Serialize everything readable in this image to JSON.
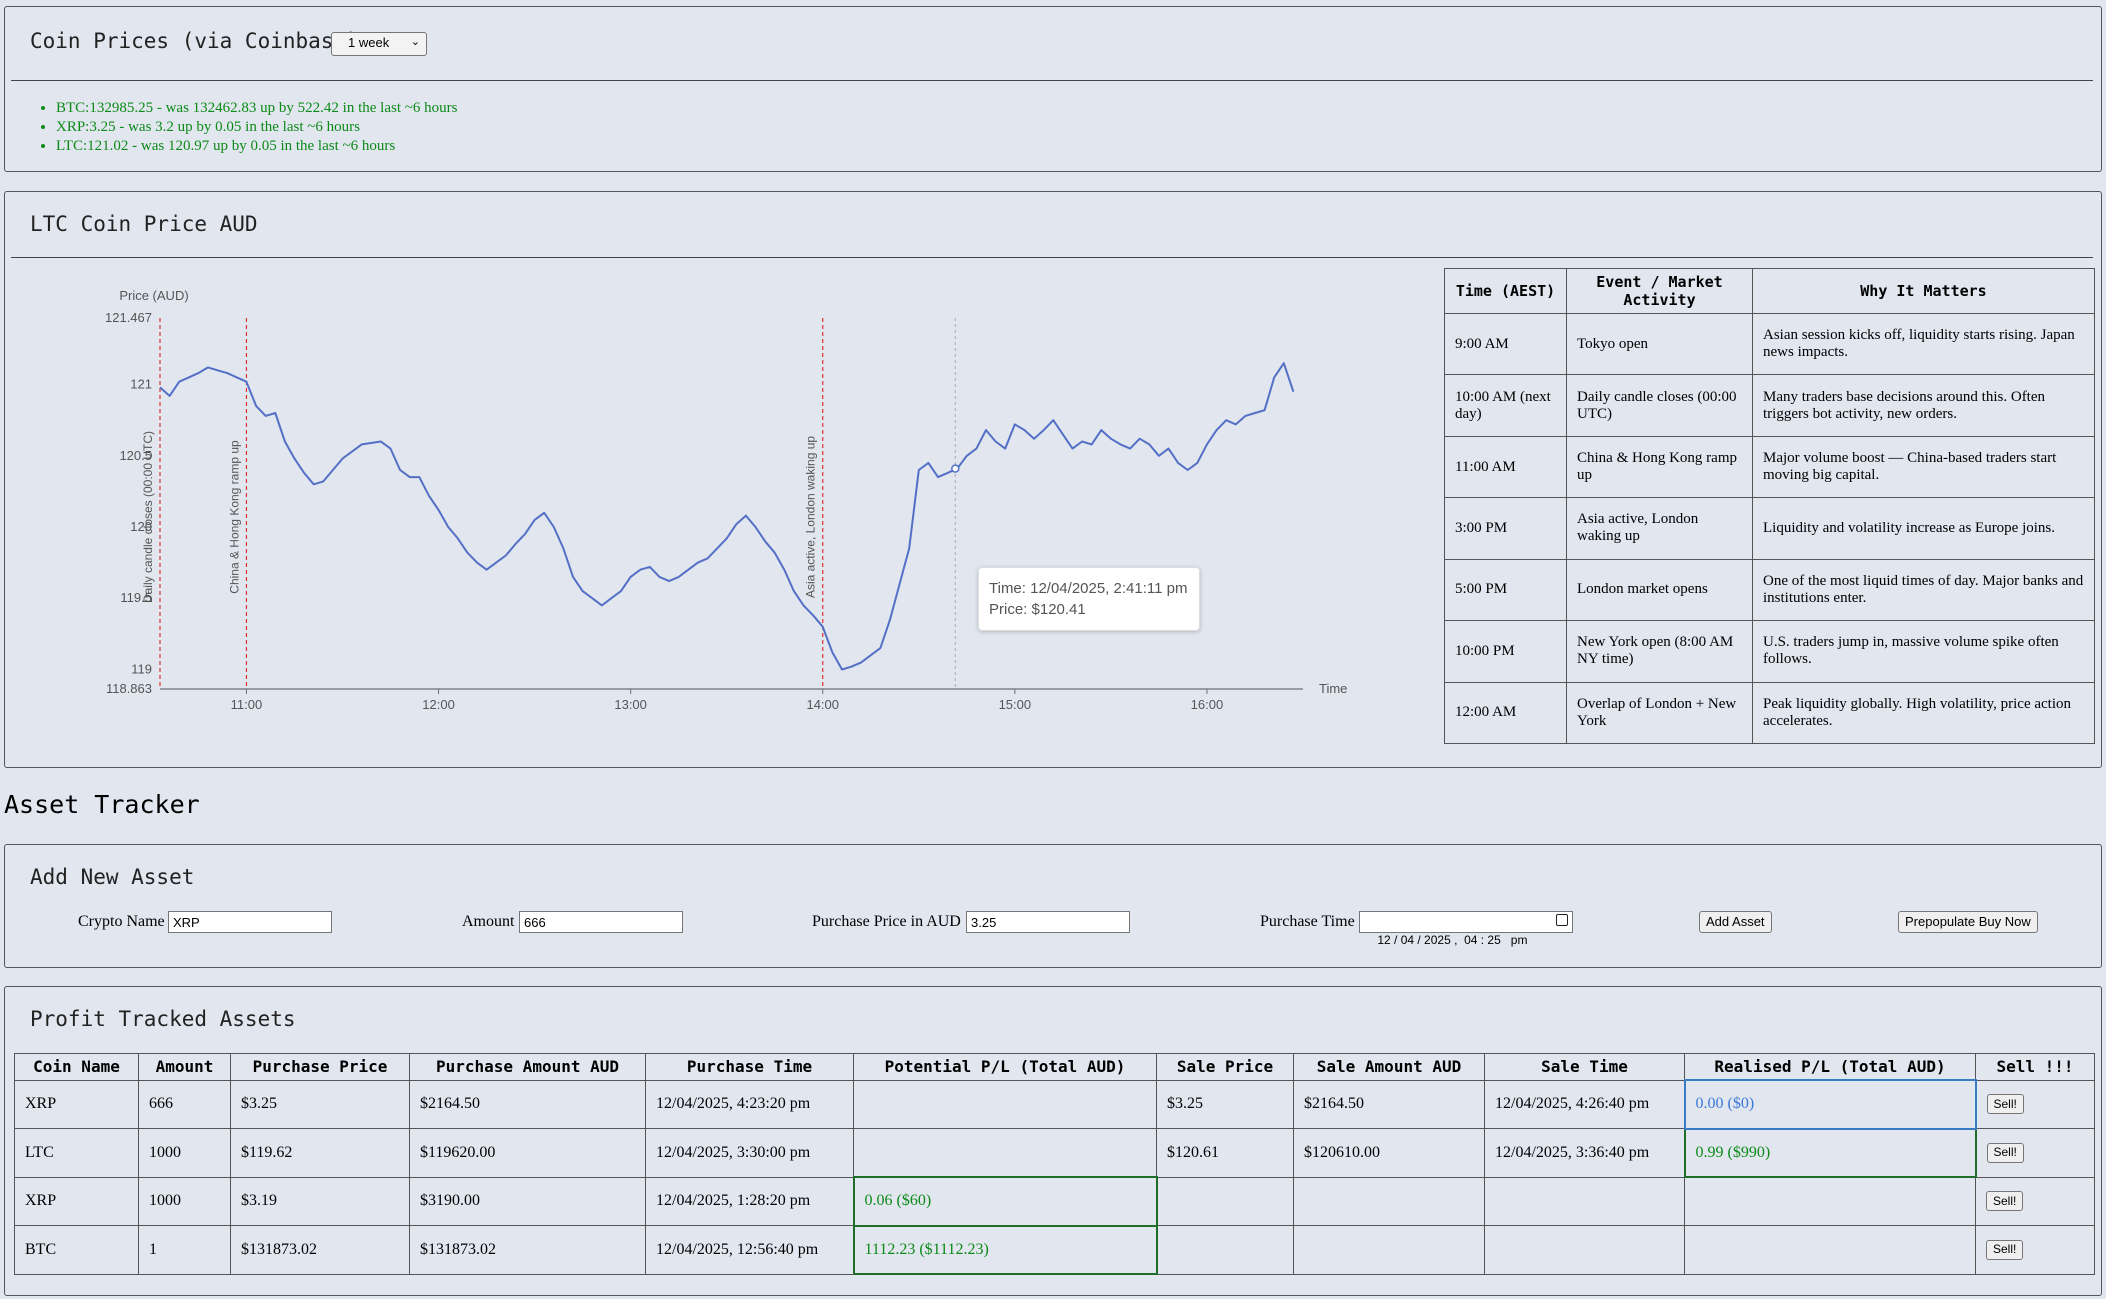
{
  "prices_panel": {
    "title": "Coin Prices (via Coinbase)",
    "range_selected": "1 week",
    "items": [
      "BTC:132985.25 - was 132462.83 up by 522.42 in the last ~6 hours",
      "XRP:3.25 - was 3.2 up by 0.05 in the last ~6 hours",
      "LTC:121.02 - was 120.97 up by 0.05 in the last ~6 hours"
    ],
    "up_color": "#0d8a18"
  },
  "chart_panel": {
    "title": "LTC Coin Price AUD",
    "tooltip": {
      "time": "Time: 12/04/2025, 2:41:11 pm",
      "price": "Price: $120.41"
    }
  },
  "chart_data": {
    "type": "line",
    "ylabel": "Price (AUD)",
    "xlabel": "Time",
    "y_ticks": [
      "121.467",
      "121",
      "120.5",
      "120",
      "119.5",
      "119",
      "118.863"
    ],
    "x_ticks": [
      "11:00",
      "12:00",
      "13:00",
      "14:00",
      "15:00",
      "16:00"
    ],
    "ylim": [
      118.863,
      121.467
    ],
    "xlim": [
      10.55,
      16.5
    ],
    "series_color": "#5470c6",
    "event_markers": [
      {
        "x": 10.55,
        "label": "Daily candle closes (00:00 UTC)"
      },
      {
        "x": 11.0,
        "label": "China & Hong Kong ramp up"
      },
      {
        "x": 14.0,
        "label": "Asia active, London waking up"
      }
    ],
    "hover_x": 14.69,
    "x": [
      10.55,
      10.6,
      10.65,
      10.7,
      10.75,
      10.8,
      10.85,
      10.9,
      10.95,
      11.0,
      11.05,
      11.1,
      11.15,
      11.2,
      11.25,
      11.3,
      11.35,
      11.4,
      11.45,
      11.5,
      11.6,
      11.7,
      11.75,
      11.8,
      11.85,
      11.9,
      11.95,
      12.0,
      12.05,
      12.1,
      12.15,
      12.2,
      12.25,
      12.3,
      12.35,
      12.4,
      12.45,
      12.5,
      12.55,
      12.6,
      12.65,
      12.7,
      12.75,
      12.8,
      12.85,
      12.9,
      12.95,
      13.0,
      13.05,
      13.1,
      13.15,
      13.2,
      13.25,
      13.3,
      13.35,
      13.4,
      13.45,
      13.5,
      13.55,
      13.6,
      13.65,
      13.7,
      13.75,
      13.8,
      13.85,
      13.9,
      13.95,
      14.0,
      14.05,
      14.1,
      14.15,
      14.2,
      14.25,
      14.3,
      14.35,
      14.4,
      14.45,
      14.5,
      14.55,
      14.6,
      14.65,
      14.7,
      14.75,
      14.8,
      14.85,
      14.9,
      14.95,
      15.0,
      15.05,
      15.1,
      15.15,
      15.2,
      15.25,
      15.3,
      15.35,
      15.4,
      15.45,
      15.5,
      15.55,
      15.6,
      15.65,
      15.7,
      15.75,
      15.8,
      15.85,
      15.9,
      15.95,
      16.0,
      16.05,
      16.1,
      16.15,
      16.2,
      16.25,
      16.3,
      16.35,
      16.4,
      16.45
    ],
    "values": [
      120.98,
      120.92,
      121.02,
      121.05,
      121.08,
      121.12,
      121.1,
      121.08,
      121.05,
      121.02,
      120.85,
      120.78,
      120.8,
      120.6,
      120.48,
      120.38,
      120.3,
      120.32,
      120.4,
      120.48,
      120.58,
      120.6,
      120.55,
      120.4,
      120.35,
      120.35,
      120.22,
      120.12,
      120.0,
      119.92,
      119.82,
      119.75,
      119.7,
      119.75,
      119.8,
      119.88,
      119.95,
      120.05,
      120.1,
      120.0,
      119.85,
      119.65,
      119.55,
      119.5,
      119.45,
      119.5,
      119.55,
      119.65,
      119.7,
      119.72,
      119.65,
      119.62,
      119.65,
      119.7,
      119.75,
      119.78,
      119.85,
      119.92,
      120.02,
      120.08,
      120.0,
      119.9,
      119.82,
      119.7,
      119.55,
      119.45,
      119.38,
      119.3,
      119.12,
      119.0,
      119.02,
      119.05,
      119.1,
      119.15,
      119.35,
      119.6,
      119.85,
      120.4,
      120.45,
      120.35,
      120.38,
      120.41,
      120.5,
      120.55,
      120.68,
      120.6,
      120.55,
      120.72,
      120.68,
      120.62,
      120.68,
      120.75,
      120.65,
      120.55,
      120.6,
      120.58,
      120.68,
      120.62,
      120.58,
      120.55,
      120.62,
      120.58,
      120.5,
      120.55,
      120.45,
      120.4,
      120.45,
      120.58,
      120.68,
      120.75,
      120.72,
      120.78,
      120.8,
      120.82,
      121.05,
      121.15,
      120.95
    ]
  },
  "events_table": {
    "headers": [
      "Time (AEST)",
      "Event / Market Activity",
      "Why It Matters"
    ],
    "rows": [
      [
        "9:00 AM",
        "Tokyo open",
        "Asian session kicks off, liquidity starts rising. Japan news impacts."
      ],
      [
        "10:00 AM (next day)",
        "Daily candle closes (00:00 UTC)",
        "Many traders base decisions around this. Often triggers bot activity, new orders."
      ],
      [
        "11:00 AM",
        "China & Hong Kong ramp up",
        "Major volume boost — China-based traders start moving big capital."
      ],
      [
        "3:00 PM",
        "Asia active, London waking up",
        "Liquidity and volatility increase as Europe joins."
      ],
      [
        "5:00 PM",
        "London market opens",
        "One of the most liquid times of day. Major banks and institutions enter."
      ],
      [
        "10:00 PM",
        "New York open (8:00 AM NY time)",
        "U.S. traders jump in, massive volume spike often follows."
      ],
      [
        "12:00 AM",
        "Overlap of London + New York",
        "Peak liquidity globally. High volatility, price action accelerates."
      ]
    ]
  },
  "asset_tracker": {
    "heading": "Asset Tracker",
    "add_panel_title": "Add New Asset",
    "crypto_label": "Crypto Name",
    "crypto_value": "XRP",
    "amount_label": "Amount",
    "amount_value": "666",
    "price_label": "Purchase Price in AUD",
    "price_value": "3.25",
    "time_label": "Purchase Time",
    "time_value": "12 / 04 / 2025 ,  04 : 25   pm",
    "add_button": "Add Asset",
    "prepopulate_button": "Prepopulate Buy Now"
  },
  "profit_table": {
    "title": "Profit Tracked Assets",
    "headers": [
      "Coin Name",
      "Amount",
      "Purchase Price",
      "Purchase Amount AUD",
      "Purchase Time",
      "Potential P/L (Total AUD)",
      "Sale Price",
      "Sale Amount AUD",
      "Sale Time",
      "Realised P/L (Total AUD)",
      "Sell !!!"
    ],
    "rows": [
      [
        "XRP",
        "666",
        "$3.25",
        "$2164.50",
        "12/04/2025, 4:23:20 pm",
        "",
        "$3.25",
        "$2164.50",
        "12/04/2025, 4:26:40 pm",
        "0.00 ($0)",
        "Sell!"
      ],
      [
        "LTC",
        "1000",
        "$119.62",
        "$119620.00",
        "12/04/2025, 3:30:00 pm",
        "",
        "$120.61",
        "$120610.00",
        "12/04/2025, 3:36:40 pm",
        "0.99 ($990)",
        "Sell!"
      ],
      [
        "XRP",
        "1000",
        "$3.19",
        "$3190.00",
        "12/04/2025, 1:28:20 pm",
        "0.06 ($60)",
        "",
        "",
        "",
        "",
        "Sell!"
      ],
      [
        "BTC",
        "1",
        "$131873.02",
        "$131873.02",
        "12/04/2025, 12:56:40 pm",
        "1112.23 ($1112.23)",
        "",
        "",
        "",
        "",
        "Sell!"
      ]
    ]
  }
}
